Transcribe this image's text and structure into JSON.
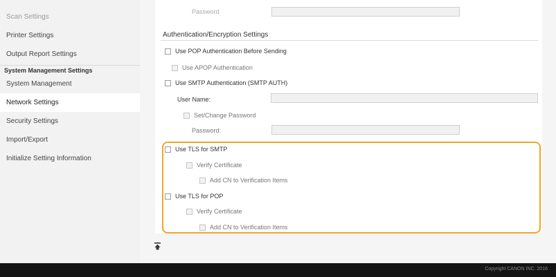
{
  "sidebar": {
    "items_top": [
      {
        "label": "Scan Settings"
      },
      {
        "label": "Printer Settings"
      },
      {
        "label": "Output Report Settings"
      }
    ],
    "section_title": "System Management Settings",
    "items_bottom": [
      {
        "label": "System Management"
      },
      {
        "label": "Network Settings"
      },
      {
        "label": "Security Settings"
      },
      {
        "label": "Import/Export"
      },
      {
        "label": "Initialize Setting Information"
      }
    ]
  },
  "form": {
    "password_top_label": "Password",
    "section_title": "Authentication/Encryption Settings",
    "use_pop_auth": "Use POP Authentication Before Sending",
    "use_apop": "Use APOP Authentication",
    "use_smtp_auth": "Use SMTP Authentication (SMTP AUTH)",
    "user_name_label": "User Name:",
    "set_change_password": "Set/Change Password",
    "password_label": "Password:",
    "use_tls_smtp": "Use TLS for SMTP",
    "verify_cert_smtp": "Verify Certificate",
    "add_cn_smtp": "Add CN to Verification Items",
    "use_tls_pop": "Use TLS for POP",
    "verify_cert_pop": "Verify Certificate",
    "add_cn_pop": "Add CN to Verification Items"
  },
  "scroll_top_icon": "scroll-to-top-icon",
  "footer": {
    "copyright": "Copyright CANON INC. 2016"
  },
  "colors": {
    "highlight": "#f0a623",
    "footer_bg": "#141414",
    "sidebar_bg": "#f2f2f2"
  }
}
